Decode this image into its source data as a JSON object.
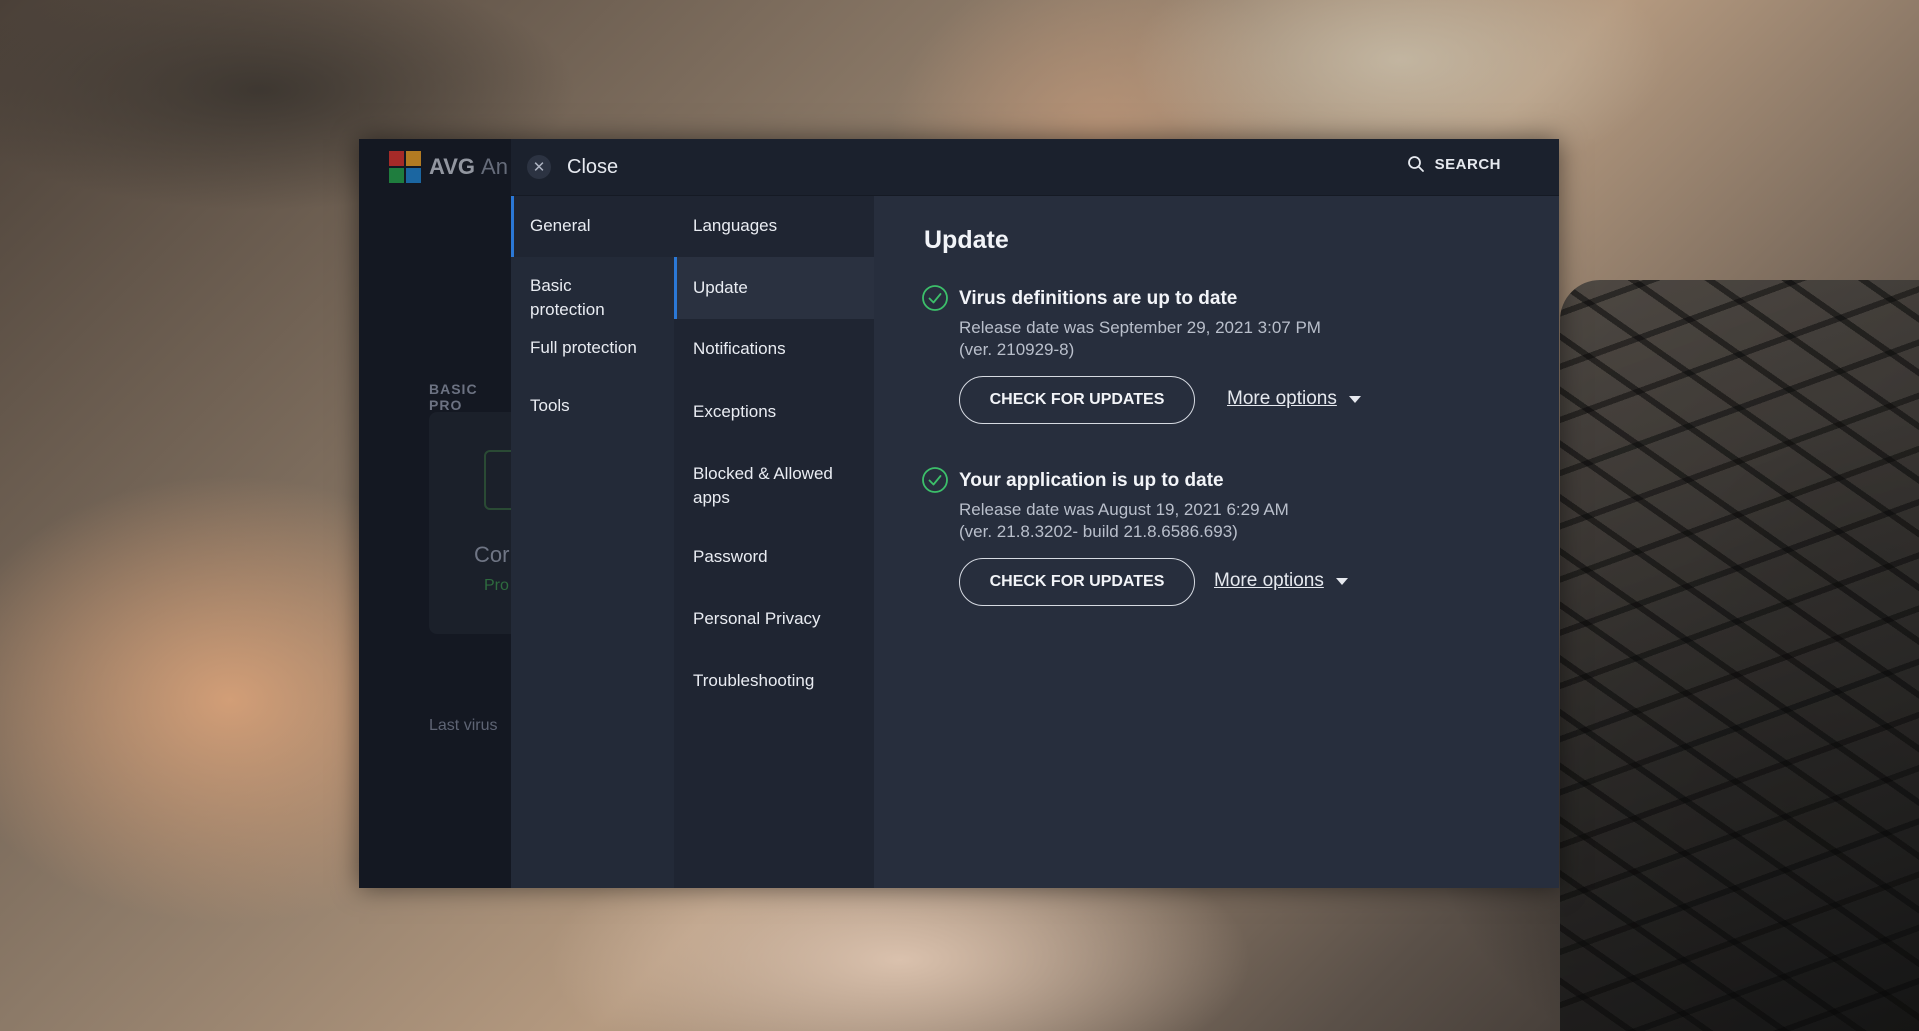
{
  "background_app": {
    "logo_text": "AVG",
    "logo_sub": "An",
    "section_label": "BASIC PRO",
    "card_title": "Cor",
    "card_sub": "Pro",
    "last_line": "Last virus"
  },
  "topbar": {
    "close_label": "Close",
    "search_label": "SEARCH"
  },
  "categories": [
    {
      "label": "General",
      "active": true
    },
    {
      "label": "Basic protection",
      "active": false
    },
    {
      "label": "Full protection",
      "active": false
    },
    {
      "label": "Tools",
      "active": false
    }
  ],
  "subitems": [
    {
      "label": "Languages",
      "active": false
    },
    {
      "label": "Update",
      "active": true
    },
    {
      "label": "Notifications",
      "active": false
    },
    {
      "label": "Exceptions",
      "active": false
    },
    {
      "label": "Blocked & Allowed apps",
      "active": false
    },
    {
      "label": "Password",
      "active": false
    },
    {
      "label": "Personal Privacy",
      "active": false
    },
    {
      "label": "Troubleshooting",
      "active": false
    }
  ],
  "update": {
    "title": "Update",
    "virus_definitions": {
      "status": "Virus definitions are up to date",
      "release": "Release date was September 29, 2021 3:07 PM",
      "version": "(ver. 210929-8)",
      "button": "CHECK FOR UPDATES",
      "more": "More options"
    },
    "application": {
      "status": "Your application is up to date",
      "release": "Release date was August 19, 2021 6:29 AM",
      "version": "(ver. 21.8.3202- build 21.8.6586.693)",
      "button": "CHECK FOR UPDATES",
      "more": "More options"
    }
  },
  "colors": {
    "accent": "#2b78d6",
    "success": "#3cbf6a"
  }
}
